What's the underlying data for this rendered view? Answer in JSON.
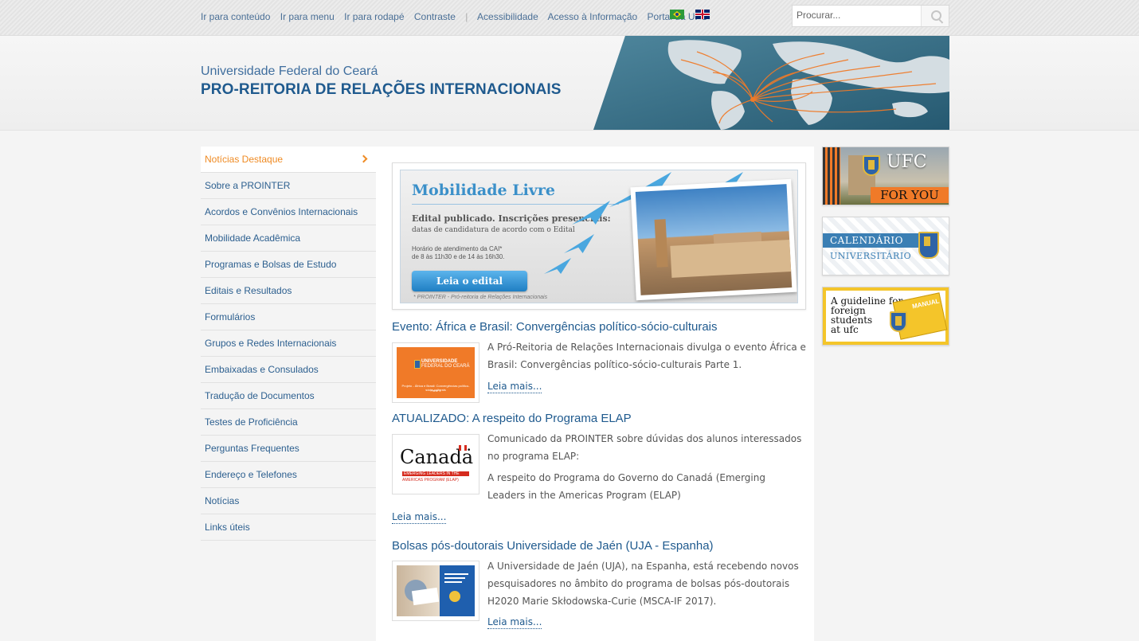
{
  "topbar": {
    "links": [
      "Ir para conteúdo",
      "Ir para menu",
      "Ir para rodapé",
      "Contraste",
      "Acessibilidade",
      "Acesso à Informação",
      "Portal da UFC"
    ],
    "separator": "|",
    "search_placeholder": "Procurar..."
  },
  "header": {
    "university": "Universidade Federal do Ceará",
    "title": "PRO-REITORIA DE RELAÇÕES INTERNACIONAIS"
  },
  "nav": {
    "items": [
      "Notícias Destaque",
      "Sobre a PROINTER",
      "Acordos e Convênios Internacionais",
      "Mobilidade Acadêmica",
      "Programas e Bolsas de Estudo",
      "Editais e Resultados",
      "Formulários",
      "Grupos e Redes Internacionais",
      "Embaixadas e Consulados",
      "Tradução de Documentos",
      "Testes de Proficiência",
      "Perguntas Frequentes",
      "Endereço e Telefones",
      "Notícias",
      "Links úteis"
    ]
  },
  "promo": {
    "title": "Mobilidade Livre",
    "line1": "Edital publicado. Inscrições presenciais:",
    "line2": "datas de candidatura de acordo com o Edital",
    "line3": "Horário de atendimento da CAI*",
    "line4": "de 8 às 11h30 e de 14 às 16h30.",
    "button": "Leia o edital",
    "credit": "* PROINTER - Pró-reitoria de Relações Internacionais"
  },
  "articles": [
    {
      "title": "Evento: África e Brasil: Convergências político-sócio-culturais",
      "paragraphs": [
        "A Pró-Reitoria de Relações Internacionais divulga o evento África e Brasil: Convergências político-sócio-culturais Parte 1."
      ],
      "more": "Leia mais...",
      "thumb_text": [
        "UNIVERSIDADE",
        "FEDERAL DO CEARÁ",
        "Projeto - África e Brasil: Convergências político-sócio-culturais",
        "Parte 1"
      ]
    },
    {
      "title": "ATUALIZADO: A respeito do Programa ELAP",
      "paragraphs": [
        "Comunicado da PROINTER sobre dúvidas dos alunos interessados no programa ELAP:",
        "A respeito do Programa do Governo do Canadá (Emerging Leaders in the Americas Program (ELAP)"
      ],
      "more": "Leia mais...",
      "thumb_text": [
        "Canadä",
        "EMERGING LEADERS IN THE",
        "AMERICAS PROGRAM (ELAP)"
      ]
    },
    {
      "title": "Bolsas pós-doutorais Universidade de Jaén (UJA - Espanha)",
      "paragraphs": [
        "A Universidade de Jaén (UJA), na Espanha, está recebendo novos pesquisadores no âmbito do programa de bolsas pós-doutorais H2020 Marie Skłodowska-Curie (MSCA-IF 2017)."
      ],
      "more": "Leia mais..."
    }
  ],
  "right_banners": {
    "ufc": {
      "logo": "UFC",
      "tag": "FOR YOU"
    },
    "calendar": {
      "line1": "CALENDÁRIO",
      "line2": "UNIVERSITÁRIO"
    },
    "guide": {
      "lines": [
        "A guideline for",
        "foreign",
        "students",
        "at ufc"
      ],
      "tag": "MANUAL"
    }
  },
  "colors": {
    "link": "#1f5a8e",
    "active": "#ef8b24",
    "accent_blue": "#3b90c9",
    "guide_yellow": "#f4c52a"
  }
}
